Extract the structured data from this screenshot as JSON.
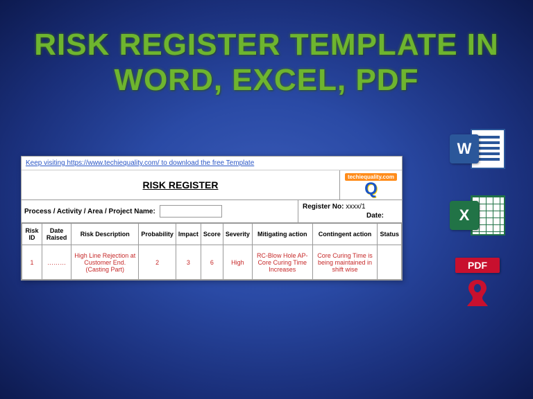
{
  "title_line1": "RISK REGISTER TEMPLATE IN",
  "title_line2": "WORD, EXCEL, PDF",
  "sheet": {
    "toplink": "Keep visiting https://www.techiequality.com/ to download the free Template",
    "header": "RISK REGISTER",
    "logo_text": "techiequality.com",
    "logo_letter": "Q",
    "meta_label": "Process / Activity / Area / Project Name:",
    "register_label": "Register No:",
    "register_value": "xxxx/1",
    "date_label": "Date:",
    "columns": [
      "Risk ID",
      "Date Raised",
      "Risk Description",
      "Probability",
      "Impact",
      "Score",
      "Severity",
      "Mitigating action",
      "Contingent action",
      "Status"
    ],
    "row": {
      "id": "1",
      "date": "………",
      "desc": "High Line Rejection at Customer End.(Casting Part)",
      "prob": "2",
      "impact": "3",
      "score": "6",
      "severity": "High",
      "mitigating": "RC-Blow Hole AP-Core Curing Time Increases",
      "contingent": "Core Curing Time is being maintained in shift wise",
      "status": ""
    }
  },
  "icons": {
    "word_letter": "W",
    "excel_letter": "X",
    "pdf_label": "PDF"
  }
}
